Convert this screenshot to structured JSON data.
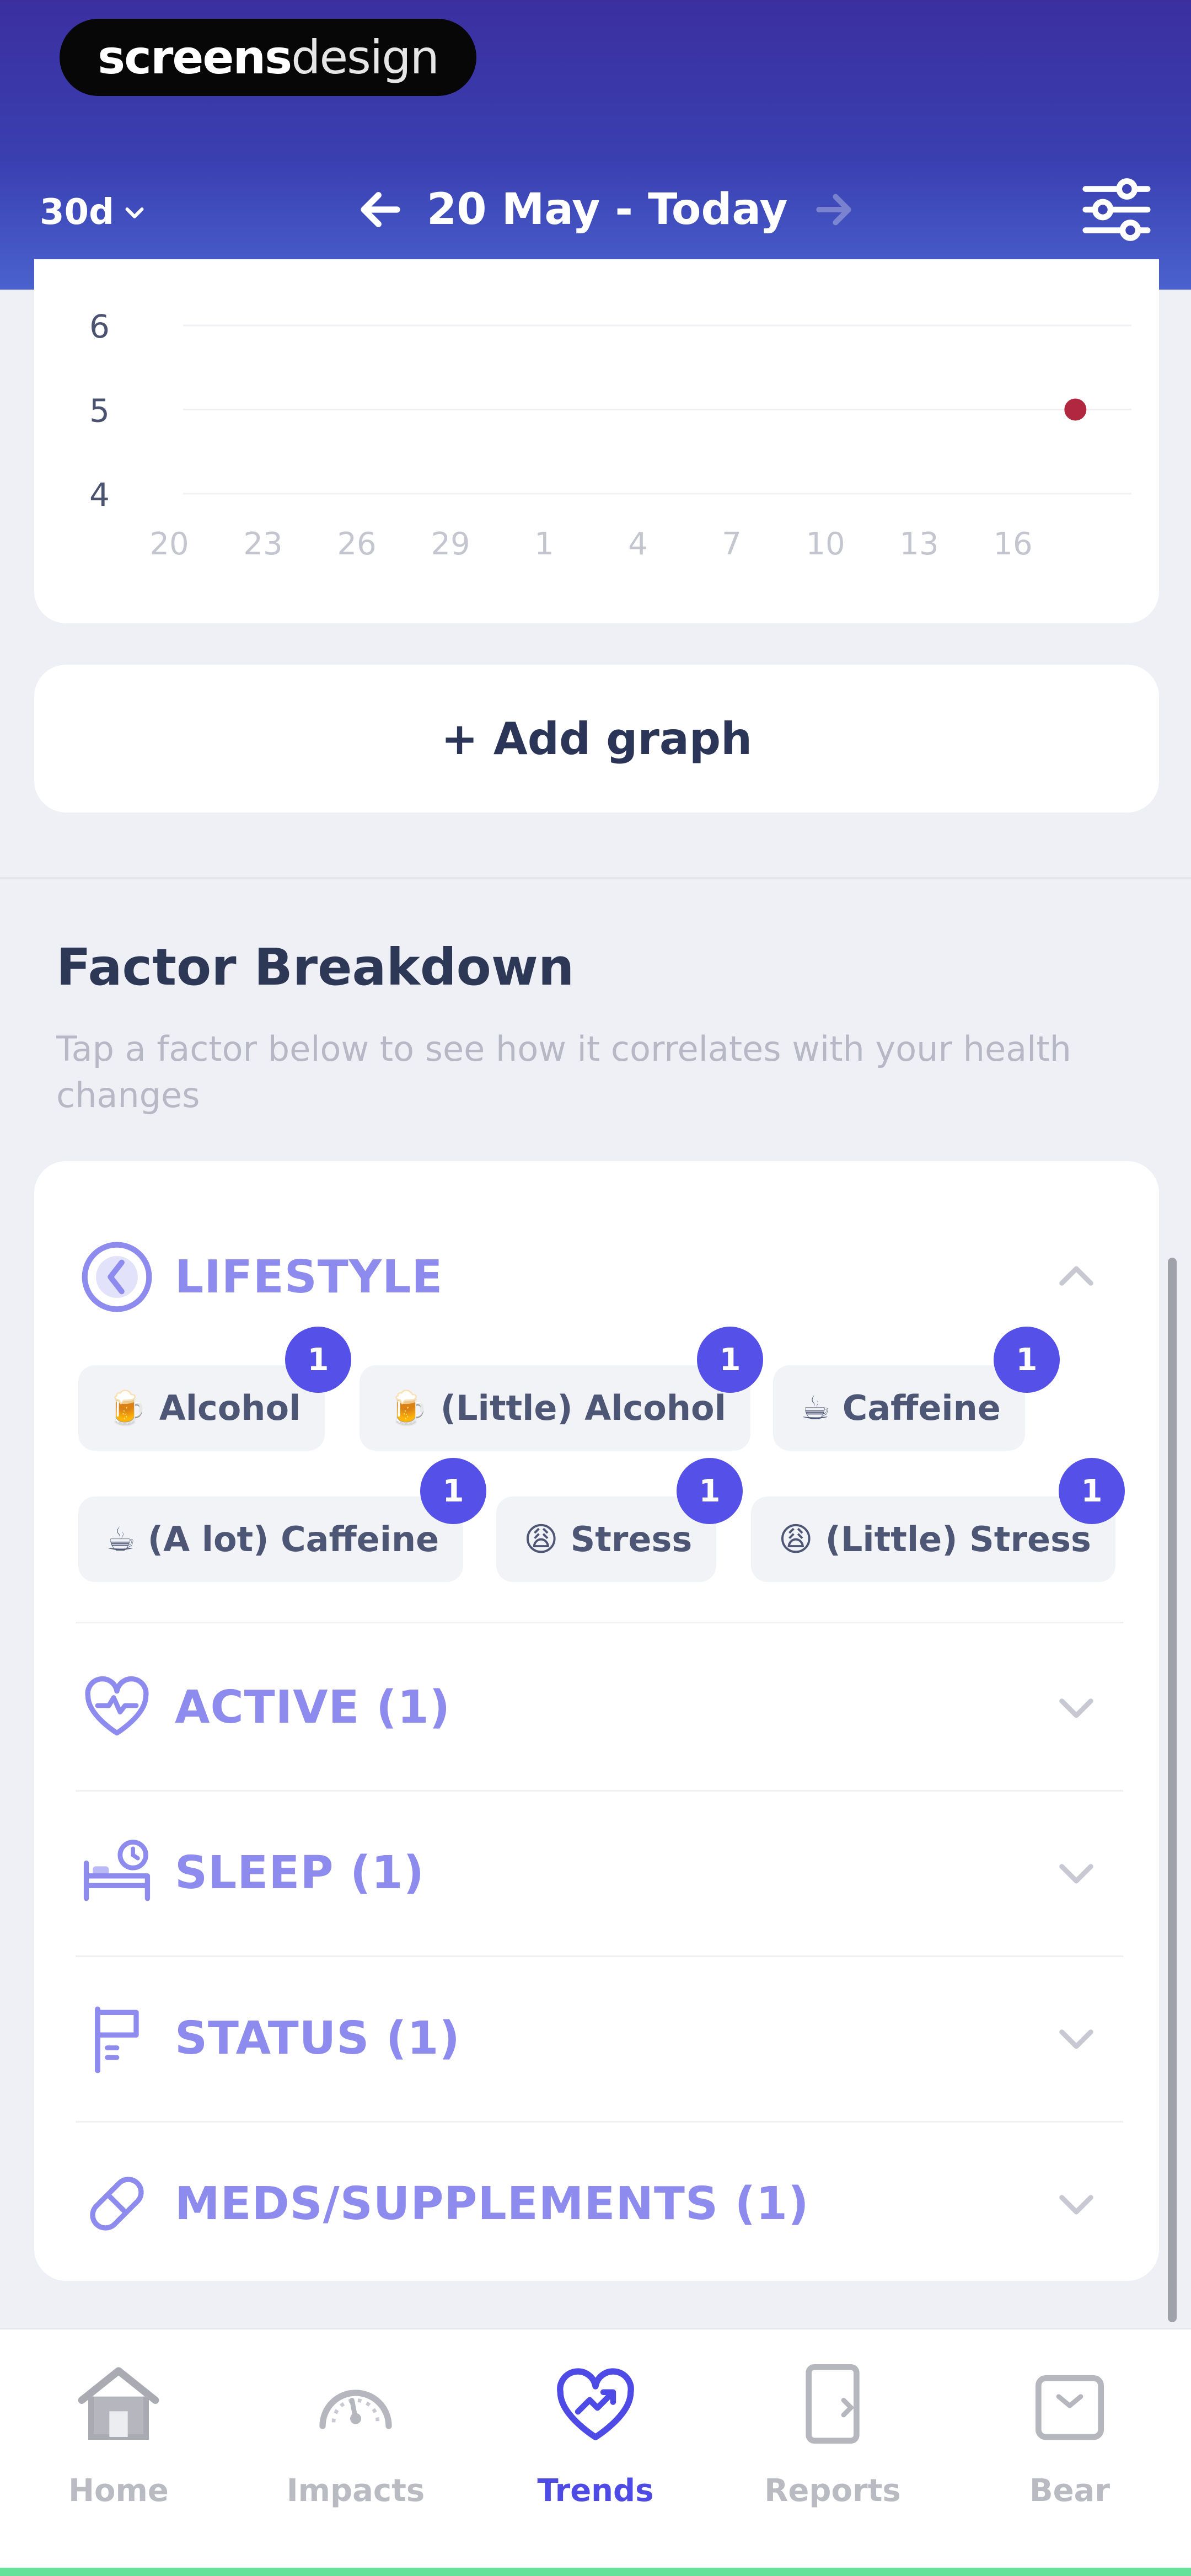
{
  "brand": {
    "bold": "screens",
    "light": "design"
  },
  "header": {
    "range": "30d",
    "date_range": "20 May - Today"
  },
  "chart_data": {
    "type": "scatter",
    "x_ticks": [
      "20",
      "23",
      "26",
      "29",
      "1",
      "4",
      "7",
      "10",
      "13",
      "16"
    ],
    "y_ticks": [
      "6",
      "5",
      "4"
    ],
    "points": [
      {
        "x": "18",
        "y": 5
      }
    ],
    "point_color": "#B0273F",
    "grid": true
  },
  "add_graph": {
    "label": "+ Add graph"
  },
  "factor_breakdown": {
    "title": "Factor Breakdown",
    "subtitle": "Tap a factor below to see how it correlates with your health changes"
  },
  "categories": {
    "lifestyle": {
      "label": "LIFESTYLE",
      "icon": "clock-icon",
      "expanded": true
    },
    "active": {
      "label": "ACTIVE (1)",
      "icon": "heart-activity-icon"
    },
    "sleep": {
      "label": "SLEEP (1)",
      "icon": "bed-icon"
    },
    "status": {
      "label": "STATUS (1)",
      "icon": "flag-icon"
    },
    "meds": {
      "label": "MEDS/SUPPLEMENTS (1)",
      "icon": "pill-icon"
    }
  },
  "lifestyle_chips": [
    {
      "emoji": "🍺",
      "label": "Alcohol",
      "count": "1"
    },
    {
      "emoji": "🍺",
      "label": "(Little) Alcohol",
      "count": "1"
    },
    {
      "emoji": "☕",
      "label": "Caffeine",
      "count": "1"
    },
    {
      "emoji": "☕",
      "label": "(A lot) Caffeine",
      "count": "1"
    },
    {
      "emoji": "😩",
      "label": "Stress",
      "count": "1"
    },
    {
      "emoji": "😩",
      "label": "(Little) Stress",
      "count": "1"
    }
  ],
  "bottom_nav": {
    "home": "Home",
    "impacts": "Impacts",
    "trends": "Trends",
    "reports": "Reports",
    "bear": "Bear"
  },
  "colors": {
    "accent": "#4E4AE6",
    "category_text": "#8E8BEF",
    "header_top": "#3B2FA0",
    "header_bottom": "#4A62CE"
  }
}
